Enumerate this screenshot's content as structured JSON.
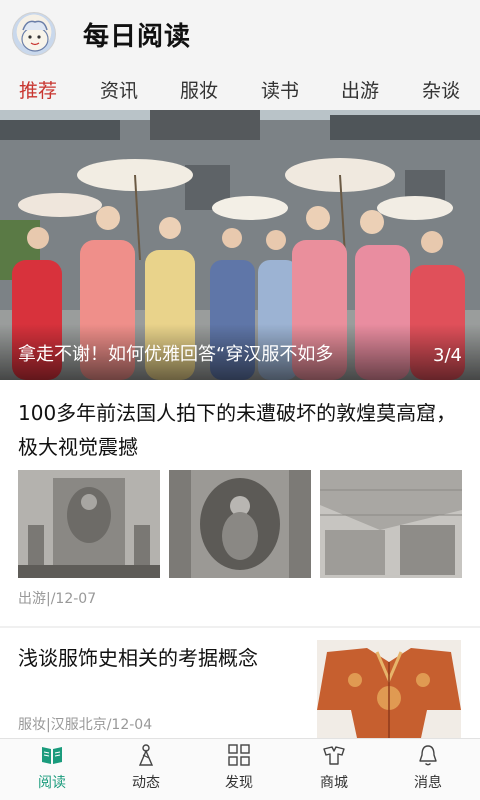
{
  "header": {
    "app_title": "每日阅读",
    "avatar_icon": "cartoon-mascot-avatar"
  },
  "tabs": [
    {
      "label": "推荐",
      "active": true
    },
    {
      "label": "资讯",
      "active": false
    },
    {
      "label": "服妆",
      "active": false
    },
    {
      "label": "读书",
      "active": false
    },
    {
      "label": "出游",
      "active": false
    },
    {
      "label": "杂谈",
      "active": false
    }
  ],
  "banner": {
    "caption": "拿走不谢！如何优雅回答“穿汉服不如多",
    "counter": "3/4"
  },
  "articles": [
    {
      "title": "100多年前法国人拍下的未遭破坏的敦煌莫高窟，极大视觉震撼",
      "meta": "出游|/12-07"
    },
    {
      "title": "浅谈服饰史相关的考据概念",
      "meta": "服妆|汉服北京/12-04"
    }
  ],
  "bottom_nav": [
    {
      "label": "阅读",
      "icon": "open-book-icon",
      "active": true
    },
    {
      "label": "动态",
      "icon": "person-hanfu-icon",
      "active": false
    },
    {
      "label": "发现",
      "icon": "grid-icon",
      "active": false
    },
    {
      "label": "商城",
      "icon": "robe-icon",
      "active": false
    },
    {
      "label": "消息",
      "icon": "bell-icon",
      "active": false
    }
  ],
  "colors": {
    "accent_red": "#c8352f",
    "nav_active_green": "#1a9b7c",
    "meta_gray": "#999999"
  }
}
